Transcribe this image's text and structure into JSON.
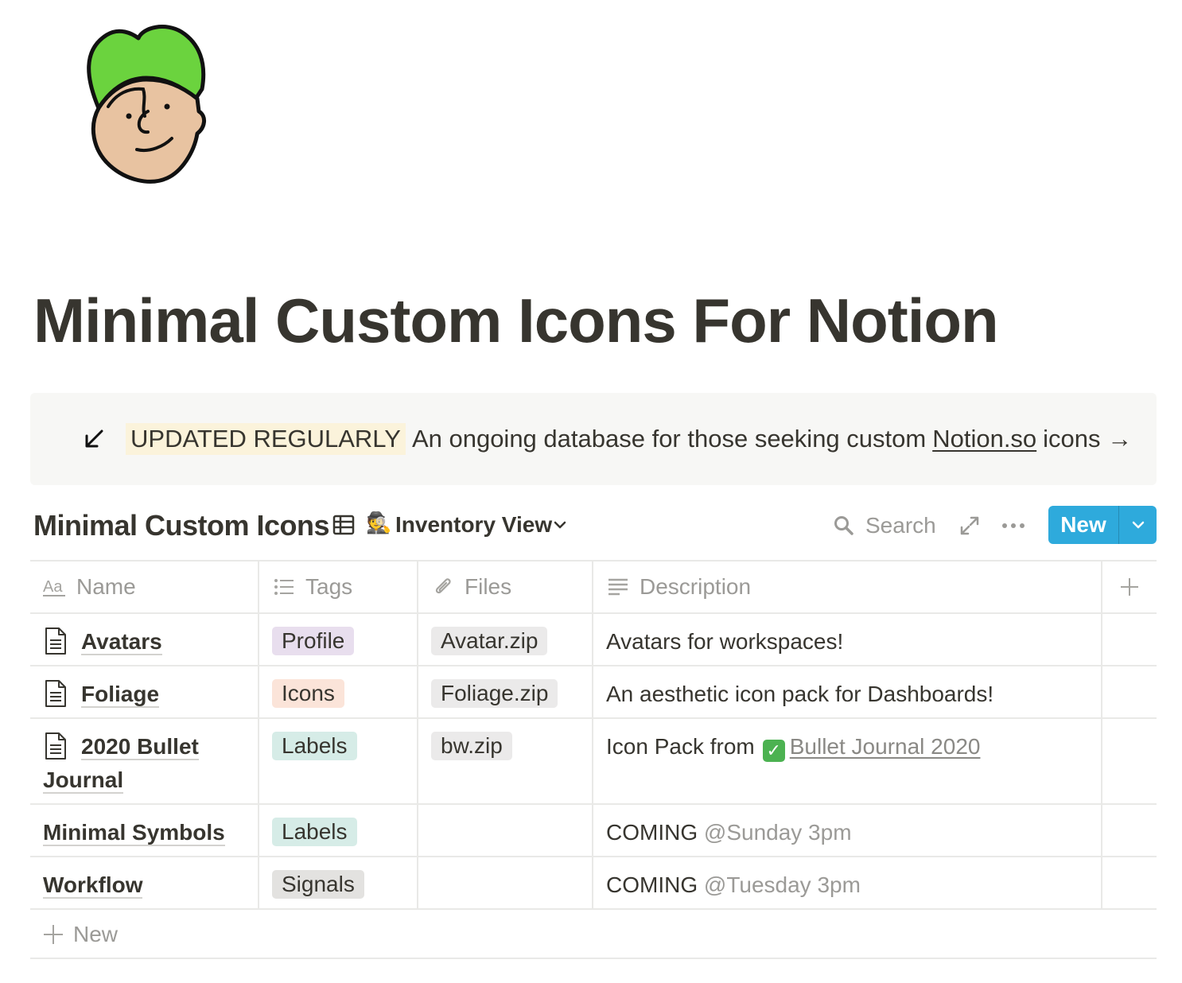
{
  "page": {
    "icon": "green-haired-avatar-icon",
    "title": "Minimal Custom Icons For Notion"
  },
  "callout": {
    "icon": "arrow-down-left-icon",
    "highlight": "UPDATED REGULARLY",
    "text_before_link": "An ongoing database for those seeking custom",
    "link": "Notion.so",
    "text_after_link": "icons →",
    "highlight_color": "#fbf3db"
  },
  "database": {
    "title": "Minimal Custom Icons",
    "view_emoji": "🕵️",
    "view_name": "Inventory View",
    "search_label": "Search",
    "new_button_label": "New",
    "accent_color": "#2eaadc"
  },
  "table": {
    "columns": [
      {
        "label": "Name",
        "icon": "title-aa-icon"
      },
      {
        "label": "Tags",
        "icon": "list-icon"
      },
      {
        "label": "Files",
        "icon": "paperclip-icon"
      },
      {
        "label": "Description",
        "icon": "text-lines-icon"
      }
    ],
    "rows": [
      {
        "name": "Avatars",
        "tag": "Profile",
        "tag_color": "#e8deee",
        "file": "Avatar.zip",
        "description": "Avatars for workspaces!"
      },
      {
        "name": "Foliage",
        "tag": "Icons",
        "tag_color": "#fbe4d9",
        "file": "Foliage.zip",
        "description": "An aesthetic icon pack for Dashboards!"
      },
      {
        "name": "2020 Bullet Journal",
        "tag": "Labels",
        "tag_color": "#d6ece7",
        "file": "bw.zip",
        "description_prefix": "Icon Pack from",
        "description_link": "Bullet Journal 2020"
      },
      {
        "name": "Minimal Symbols",
        "tag": "Labels",
        "tag_color": "#d6ece7",
        "description_prefix": "COMING",
        "mention": "@Sunday 3pm"
      },
      {
        "name": "Workflow",
        "tag": "Signals",
        "tag_color": "#e3e2e0",
        "description_prefix": "COMING",
        "mention": "@Tuesday 3pm"
      }
    ],
    "new_row_label": "New"
  }
}
